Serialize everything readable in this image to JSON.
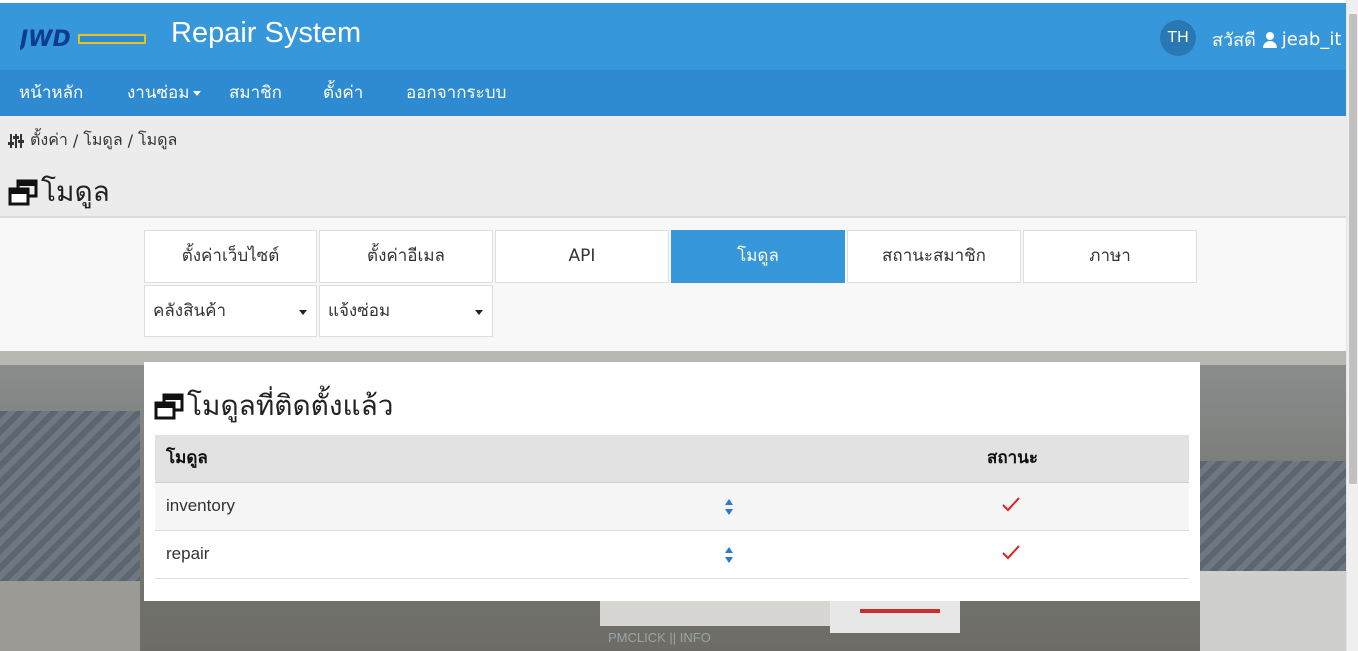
{
  "header": {
    "logo_text": "JWD",
    "app_title": "Repair System",
    "lang": "TH",
    "greeting": "สวัสดี",
    "username": "jeab_it"
  },
  "nav": {
    "items": [
      {
        "label": "หน้าหลัก"
      },
      {
        "label": "งานซ่อม"
      },
      {
        "label": "สมาชิก"
      },
      {
        "label": "ตั้งค่า"
      },
      {
        "label": "ออกจากระบบ"
      }
    ]
  },
  "breadcrumb": {
    "items": [
      "ตั้งค่า",
      "โมดูล",
      "โมดูล"
    ],
    "separator": "/"
  },
  "page_title": "โมดูล",
  "tabs": [
    {
      "label": "ตั้งค่าเว็บไซต์",
      "active": false
    },
    {
      "label": "ตั้งค่าอีเมล",
      "active": false
    },
    {
      "label": "API",
      "active": false
    },
    {
      "label": "โมดูล",
      "active": true
    },
    {
      "label": "สถานะสมาชิก",
      "active": false
    },
    {
      "label": "ภาษา",
      "active": false
    }
  ],
  "selects": [
    {
      "value": "คลังสินค้า"
    },
    {
      "value": "แจ้งซ่อม"
    }
  ],
  "card": {
    "title": "โมดูลที่ติดตั้งแล้ว",
    "columns": [
      "โมดูล",
      "สถานะ"
    ],
    "rows": [
      {
        "name": "inventory",
        "status_icon": "check-icon"
      },
      {
        "name": "repair",
        "status_icon": "check-icon"
      }
    ]
  },
  "footer": {
    "text": "PMCLICK || INFO"
  },
  "colors": {
    "header": "#3797db",
    "navbar": "#2e8bd2",
    "active_tab": "#3797db",
    "check": "#e02020",
    "sort_handle": "#2a78c7"
  }
}
